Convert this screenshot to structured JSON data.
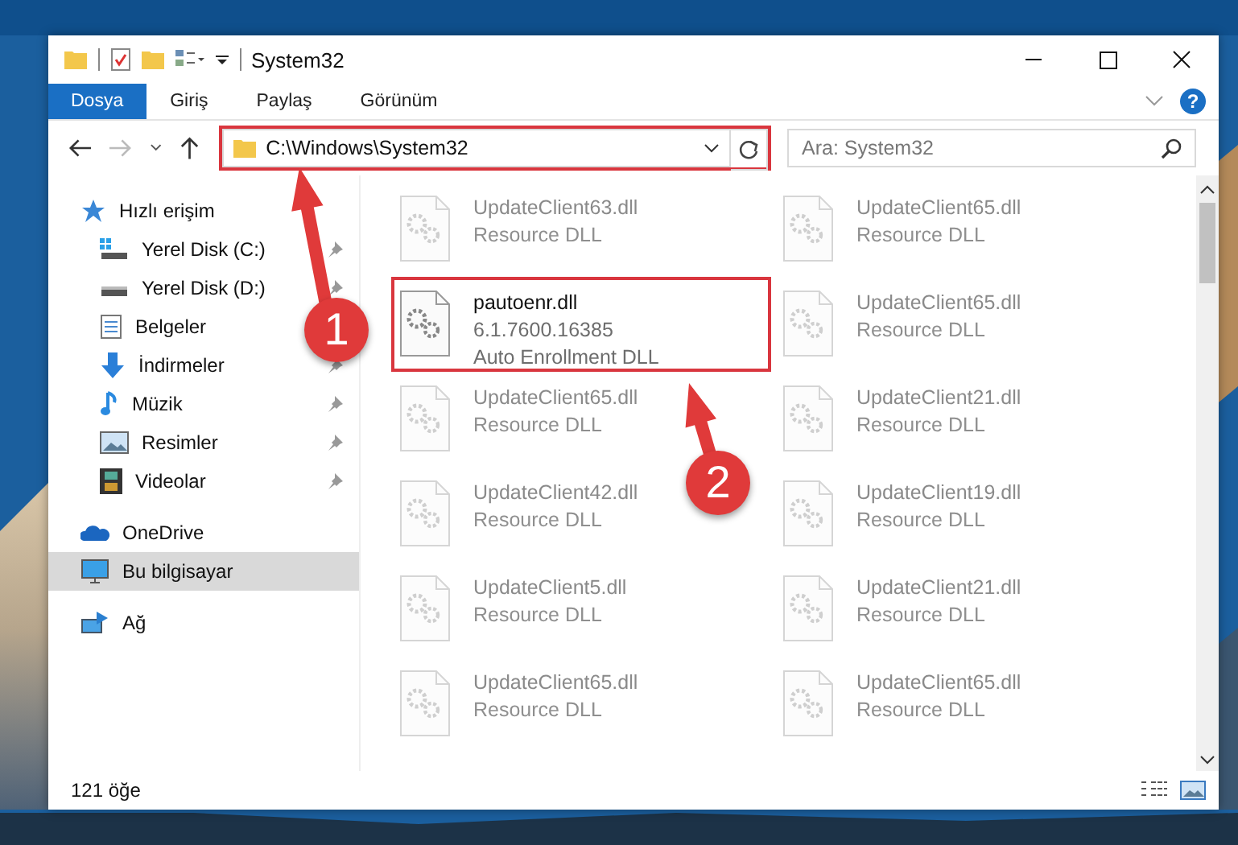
{
  "window": {
    "title": "System32"
  },
  "ribbon_tabs": [
    {
      "label": "Dosya",
      "selected": true
    },
    {
      "label": "Giriş",
      "selected": false
    },
    {
      "label": "Paylaş",
      "selected": false
    },
    {
      "label": "Görünüm",
      "selected": false
    }
  ],
  "help": "?",
  "address": {
    "path": "C:\\Windows\\System32",
    "highlighted": true,
    "forward_disabled": true
  },
  "search": {
    "placeholder": "Ara: System32"
  },
  "sidebar": {
    "items": [
      {
        "label": "Hızlı erişim",
        "kind": "star",
        "selected": false,
        "children": [
          {
            "label": "Yerel Disk (C:)",
            "kind": "drive-c",
            "pinned": true
          },
          {
            "label": "Yerel Disk (D:)",
            "kind": "drive",
            "pinned": true
          },
          {
            "label": "Belgeler",
            "kind": "documents"
          },
          {
            "label": "İndirmeler",
            "kind": "downloads",
            "pinned": true
          },
          {
            "label": "Müzik",
            "kind": "music",
            "pinned": true
          },
          {
            "label": "Resimler",
            "kind": "pictures",
            "pinned": true
          },
          {
            "label": "Videolar",
            "kind": "videos",
            "pinned": true
          }
        ]
      },
      {
        "label": "OneDrive",
        "kind": "cloud",
        "selected": false
      },
      {
        "label": "Bu bilgisayar",
        "kind": "computer",
        "selected": true
      },
      {
        "label": "Ağ",
        "kind": "network",
        "selected": false
      }
    ]
  },
  "files": [
    {
      "name": "UpdateClient63.dll",
      "lines": [
        "Resource DLL"
      ],
      "highlighted": false,
      "faded": true
    },
    {
      "name": "UpdateClient65.dll",
      "lines": [
        "Resource DLL"
      ],
      "highlighted": false,
      "faded": true
    },
    {
      "name": "pautoenr.dll",
      "lines": [
        "6.1.7600.16385",
        "Auto Enrollment DLL"
      ],
      "highlighted": true,
      "faded": false
    },
    {
      "name": "UpdateClient65.dll",
      "lines": [
        "Resource DLL"
      ],
      "highlighted": false,
      "faded": true
    },
    {
      "name": "UpdateClient65.dll",
      "lines": [
        "Resource DLL"
      ],
      "highlighted": false,
      "faded": true
    },
    {
      "name": "UpdateClient21.dll",
      "lines": [
        "Resource DLL"
      ],
      "highlighted": false,
      "faded": true
    },
    {
      "name": "UpdateClient42.dll",
      "lines": [
        "Resource DLL"
      ],
      "highlighted": false,
      "faded": true
    },
    {
      "name": "UpdateClient19.dll",
      "lines": [
        "Resource DLL"
      ],
      "highlighted": false,
      "faded": true
    },
    {
      "name": "UpdateClient5.dll",
      "lines": [
        "Resource DLL"
      ],
      "highlighted": false,
      "faded": true
    },
    {
      "name": "UpdateClient21.dll",
      "lines": [
        "Resource DLL"
      ],
      "highlighted": false,
      "faded": true
    },
    {
      "name": "UpdateClient65.dll",
      "lines": [
        "Resource DLL"
      ],
      "highlighted": false,
      "faded": true
    },
    {
      "name": "UpdateClient65.dll",
      "lines": [
        "Resource DLL"
      ],
      "highlighted": false,
      "faded": true
    }
  ],
  "status_bar": {
    "count": "121 öğe"
  },
  "annotations": [
    {
      "label": "1"
    },
    {
      "label": "2"
    }
  ]
}
